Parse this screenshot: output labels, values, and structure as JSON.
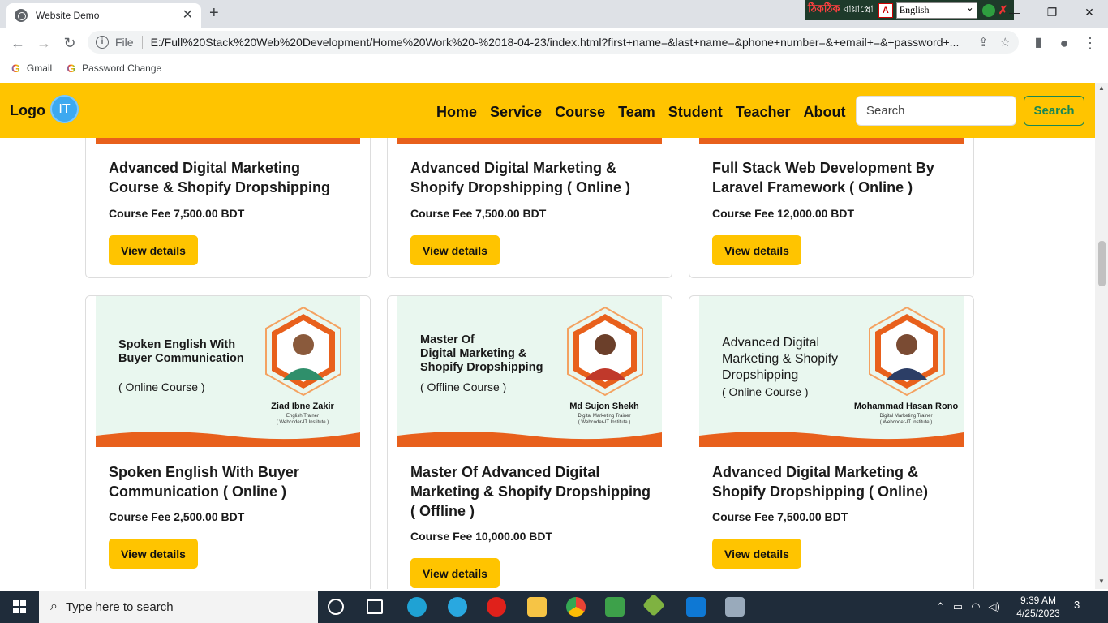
{
  "browser": {
    "tab_title": "Website Demo",
    "new_tab": "+",
    "url_label": "File",
    "url": "E:/Full%20Stack%20Web%20Development/Home%20Work%20-%2018-04-23/index.html?first+name=&last+name=&phone+number=&+email+=&+password+...",
    "bookmarks": [
      "Gmail",
      "Password Change"
    ],
    "translator": {
      "bn_logo": "ঠিকঠিক",
      "bn_text": "বায়াস্ত্রো",
      "language": "English"
    }
  },
  "site": {
    "logo_text": "Logo",
    "logo_badge": "IT",
    "nav": [
      "Home",
      "Service",
      "Course",
      "Team",
      "Student",
      "Teacher",
      "About"
    ],
    "search_placeholder": "Search",
    "search_button": "Search",
    "colors": {
      "brand": "#ffc400",
      "accent": "#e8601c",
      "success": "#198754"
    }
  },
  "cards_top": [
    {
      "title": "Advanced Digital Marketing Course & Shopify Dropshipping",
      "fee": "Course Fee 7,500.00 BDT",
      "button": "View details"
    },
    {
      "title": "Advanced Digital Marketing & Shopify Dropshipping ( Online )",
      "fee": "Course Fee 7,500.00 BDT",
      "button": "View details"
    },
    {
      "title": "Full Stack Web Development By Laravel Framework ( Online )",
      "fee": "Course Fee 12,000.00 BDT",
      "button": "View details"
    }
  ],
  "cards_bottom": [
    {
      "banner_title": "Spoken English With\nBuyer Communication",
      "banner_sub": "( Online Course )",
      "trainer": "Ziad Ibne Zakir",
      "trainer_role": "English Trainer",
      "institute": "( Webcoder-IT Institute )",
      "title": "Spoken English With Buyer Communication ( Online )",
      "fee": "Course Fee 2,500.00 BDT",
      "button": "View details"
    },
    {
      "banner_title": "Master Of\nDigital Marketing &\nShopify Dropshipping",
      "banner_sub": "( Offline Course )",
      "trainer": "Md Sujon Shekh",
      "trainer_role": "Digital Marketing Trainer",
      "institute": "( Webcoder-IT Institute )",
      "title": "Master Of Advanced Digital Marketing & Shopify Dropshipping ( Offline )",
      "fee": "Course Fee 10,000.00 BDT",
      "button": "View details"
    },
    {
      "banner_title": "Advanced Digital\nMarketing & Shopify\nDropshipping",
      "banner_sub": "( Online Course )",
      "trainer": "Mohammad Hasan Rono",
      "trainer_role": "Digital Marketing Trainer",
      "institute": "( Webcoder-IT Institute )",
      "title": "Advanced Digital Marketing & Shopify Dropshipping ( Online)",
      "fee": "Course Fee 7,500.00 BDT",
      "button": "View details"
    }
  ],
  "taskbar": {
    "search_placeholder": "Type here to search",
    "time": "9:39 AM",
    "date": "4/25/2023",
    "notifications": "3"
  }
}
